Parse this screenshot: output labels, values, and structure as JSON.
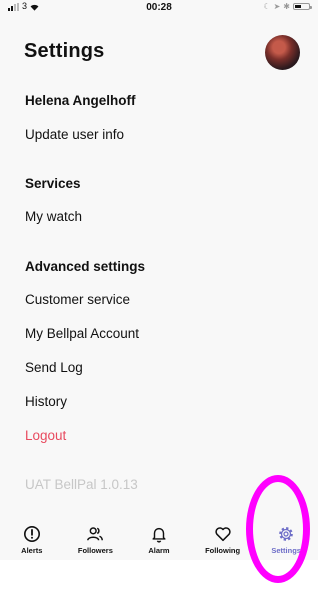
{
  "status_bar": {
    "carrier": "3",
    "time": "00:28"
  },
  "header": {
    "title": "Settings"
  },
  "account": {
    "name": "Helena Angelhoff",
    "update_label": "Update user info"
  },
  "services": {
    "heading": "Services",
    "items": [
      "My watch"
    ]
  },
  "advanced": {
    "heading": "Advanced settings",
    "items": [
      "Customer service",
      "My Bellpal Account",
      "Send Log",
      "History"
    ]
  },
  "logout_label": "Logout",
  "version": "UAT BellPal 1.0.13",
  "tabs": [
    {
      "label": "Alerts",
      "icon": "alert-circle-icon"
    },
    {
      "label": "Followers",
      "icon": "users-icon"
    },
    {
      "label": "Alarm",
      "icon": "bell-icon"
    },
    {
      "label": "Following",
      "icon": "heart-icon"
    },
    {
      "label": "Settings",
      "icon": "gear-icon",
      "active": true
    }
  ],
  "colors": {
    "accent": "#6e6ec8",
    "logout": "#e84a5f",
    "annotation": "#ff00ff",
    "version": "#c7c7c7"
  }
}
